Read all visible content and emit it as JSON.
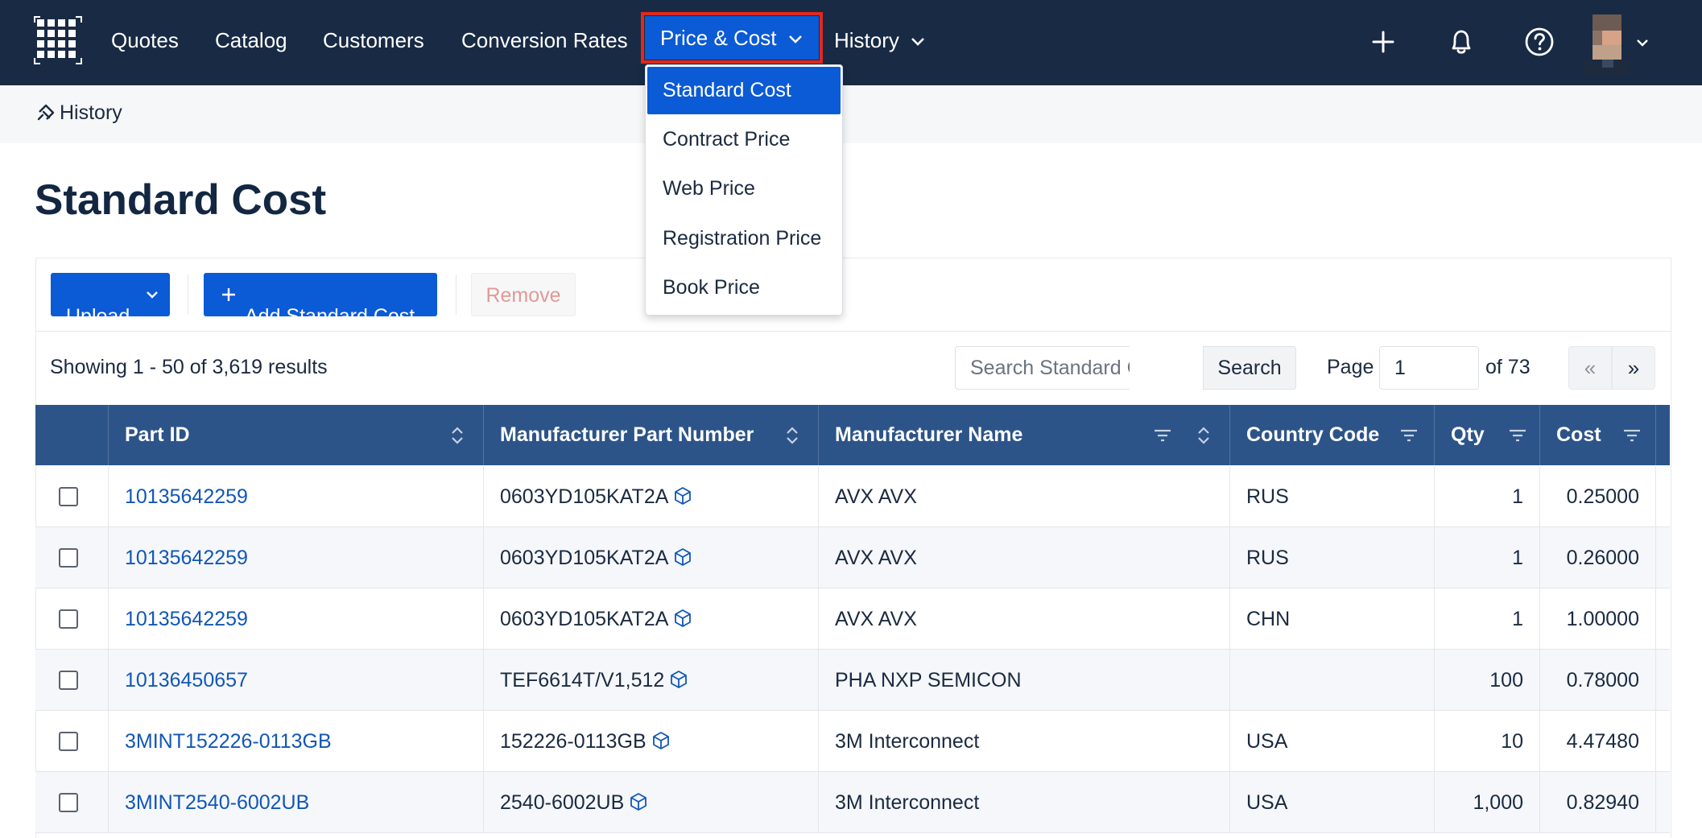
{
  "nav": {
    "items": [
      {
        "label": "Quotes"
      },
      {
        "label": "Catalog"
      },
      {
        "label": "Customers"
      },
      {
        "label": "Conversion Rates"
      },
      {
        "label": "Price & Cost"
      },
      {
        "label": "History"
      }
    ],
    "active_item": "Price & Cost",
    "icons": [
      "apps-grid-icon",
      "plus-icon",
      "bell-icon",
      "help-icon",
      "avatar",
      "chevron-down-icon"
    ]
  },
  "dropdown": {
    "items": [
      {
        "label": "Standard Cost",
        "selected": true
      },
      {
        "label": "Contract Price",
        "selected": false
      },
      {
        "label": "Web Price",
        "selected": false
      },
      {
        "label": "Registration Price",
        "selected": false
      },
      {
        "label": "Book Price",
        "selected": false
      }
    ]
  },
  "breadcrumb": {
    "label": "History"
  },
  "page": {
    "title": "Standard Cost"
  },
  "toolbar": {
    "upload_label": "Upload",
    "add_label": "Add Standard Cost",
    "remove_label": "Remove"
  },
  "listing": {
    "showing": "Showing 1 - 50 of 3,619 results",
    "search_placeholder": "Search Standard Costs",
    "search_label": "Search",
    "page_label": "Page",
    "page_value": "1",
    "of_label": "of 73",
    "prev_label": "«",
    "next_label": "»"
  },
  "table": {
    "columns": [
      "Part ID",
      "Manufacturer Part Number",
      "Manufacturer Name",
      "Country Code",
      "Qty",
      "Cost"
    ],
    "rows": [
      {
        "part_id": "10135642259",
        "mpn": "0603YD105KAT2A",
        "manufacturer": "AVX AVX",
        "country": "RUS",
        "qty": "1",
        "cost": "0.25000"
      },
      {
        "part_id": "10135642259",
        "mpn": "0603YD105KAT2A",
        "manufacturer": "AVX AVX",
        "country": "RUS",
        "qty": "1",
        "cost": "0.26000"
      },
      {
        "part_id": "10135642259",
        "mpn": "0603YD105KAT2A",
        "manufacturer": "AVX AVX",
        "country": "CHN",
        "qty": "1",
        "cost": "1.00000"
      },
      {
        "part_id": "10136450657",
        "mpn": "TEF6614T/V1,512",
        "manufacturer": "PHA NXP SEMICON",
        "country": "",
        "qty": "100",
        "cost": "0.78000"
      },
      {
        "part_id": "3MINT152226-0113GB",
        "mpn": "152226-0113GB",
        "manufacturer": "3M Interconnect",
        "country": "USA",
        "qty": "10",
        "cost": "4.47480"
      },
      {
        "part_id": "3MINT2540-6002UB",
        "mpn": "2540-6002UB",
        "manufacturer": "3M Interconnect",
        "country": "USA",
        "qty": "1,000",
        "cost": "0.82940"
      }
    ]
  },
  "colors": {
    "nav_bg": "#182a44",
    "accent": "#0b5ad6",
    "highlight_outline": "#e3281d",
    "table_header": "#2d5489",
    "link": "#1156b8"
  }
}
